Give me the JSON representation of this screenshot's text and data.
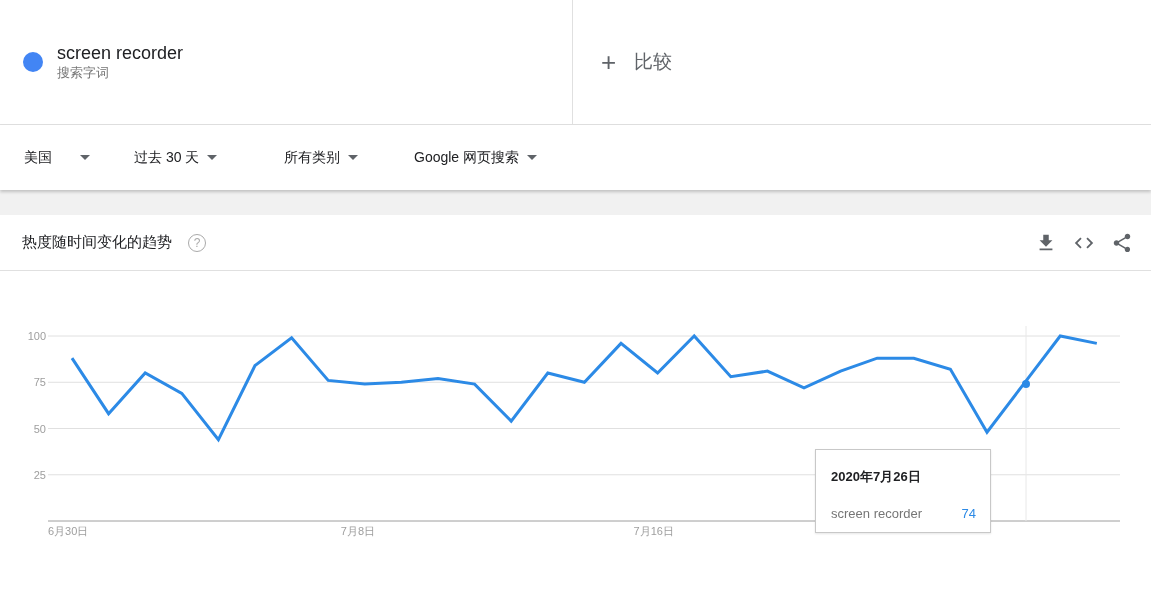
{
  "term": {
    "name": "screen recorder",
    "subtitle": "搜索字词",
    "color": "#4285f4"
  },
  "compare": {
    "icon": "+",
    "label": "比较"
  },
  "filters": [
    "美国",
    "过去 30 天",
    "所有类别",
    "Google 网页搜索"
  ],
  "trend_card": {
    "title": "热度随时间变化的趋势",
    "help": "?",
    "chart_data": {
      "type": "line",
      "categories": [
        "6月30日",
        null,
        null,
        null,
        null,
        null,
        null,
        null,
        "7月8日",
        null,
        null,
        null,
        null,
        null,
        null,
        null,
        "7月16日",
        null,
        null,
        null,
        null,
        null,
        null,
        null,
        null,
        null,
        null,
        null,
        null
      ],
      "series": [
        {
          "name": "screen recorder",
          "color": "#2c8ae6",
          "values": [
            88,
            58,
            80,
            69,
            44,
            84,
            99,
            76,
            74,
            75,
            77,
            74,
            54,
            80,
            75,
            96,
            80,
            100,
            78,
            81,
            72,
            81,
            88,
            88,
            82,
            48,
            74,
            100,
            96
          ]
        }
      ],
      "ylim": [
        0,
        100
      ],
      "yticks": [
        25,
        50,
        75,
        100
      ],
      "grid": true
    },
    "tooltip": {
      "title": "2020年7月26日",
      "value": "74"
    }
  }
}
